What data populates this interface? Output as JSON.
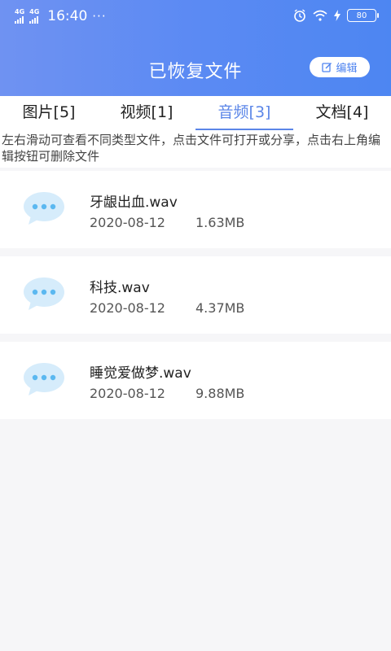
{
  "status": {
    "net1": "4G",
    "net2": "4G",
    "time": "16:40",
    "dots": "···",
    "battery": "80"
  },
  "header": {
    "title": "已恢复文件",
    "edit_label": "编辑"
  },
  "tabs": [
    {
      "label": "图片[5]",
      "active": false
    },
    {
      "label": "视频[1]",
      "active": false
    },
    {
      "label": "音频[3]",
      "active": true
    },
    {
      "label": "文档[4]",
      "active": false
    }
  ],
  "hint": "左右滑动可查看不同类型文件，点击文件可打开或分享，点击右上角编辑按钮可删除文件",
  "files": [
    {
      "name": "牙龈出血.wav",
      "date": "2020-08-12",
      "size": "1.63MB"
    },
    {
      "name": "科技.wav",
      "date": "2020-08-12",
      "size": "4.37MB"
    },
    {
      "name": "睡觉爱做梦.wav",
      "date": "2020-08-12",
      "size": "9.88MB"
    }
  ],
  "colors": {
    "accent": "#5b86e8",
    "header_start": "#6f92f2",
    "header_end": "#4d86f2",
    "bubble": "#d6ecfb",
    "bubble_dots": "#5bb8f0"
  },
  "icons": {
    "status": [
      "signal-icon",
      "alarm-icon",
      "wifi-icon",
      "charging-icon",
      "battery-icon"
    ],
    "edit": "edit-icon",
    "file": "audio-chat-bubble-icon"
  }
}
